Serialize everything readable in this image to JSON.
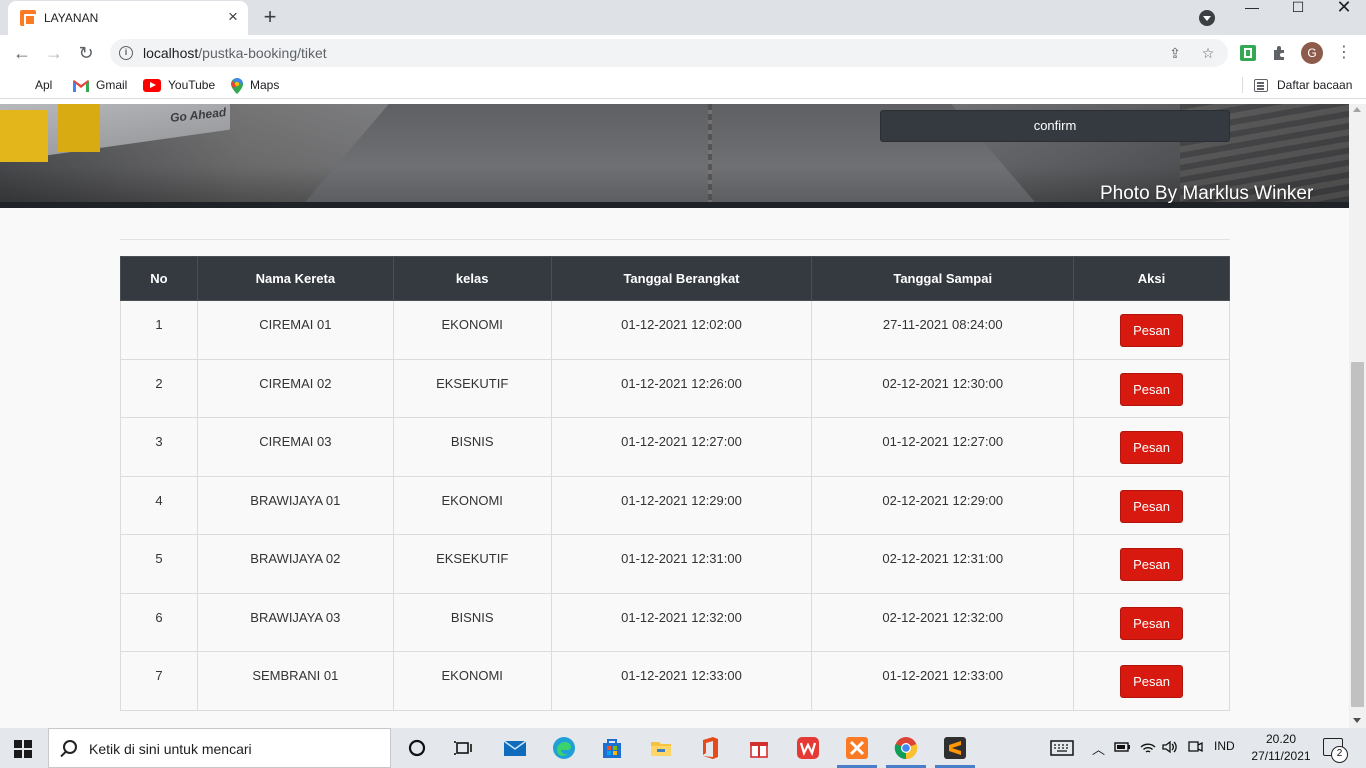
{
  "browser": {
    "tab_title": "LAYANAN",
    "url_host": "localhost",
    "url_path": "/pustka-booking/tiket",
    "bookmarks": [
      {
        "label": "Apl",
        "icon": "apps-grid-icon"
      },
      {
        "label": "Gmail",
        "icon": "gmail-icon"
      },
      {
        "label": "YouTube",
        "icon": "youtube-icon"
      },
      {
        "label": "Maps",
        "icon": "maps-icon"
      }
    ],
    "reading_list": "Daftar bacaan",
    "profile_initial": "G"
  },
  "hero": {
    "brand_text": "Go Ahead",
    "confirm_label": "confirm",
    "photo_credit": "Photo By Marklus Winker"
  },
  "table": {
    "headers": [
      "No",
      "Nama Kereta",
      "kelas",
      "Tanggal Berangkat",
      "Tanggal Sampai",
      "Aksi"
    ],
    "rows": [
      {
        "no": "1",
        "nama": "CIREMAI 01",
        "kelas": "EKONOMI",
        "berangkat": "01-12-2021 12:02:00",
        "sampai": "27-11-2021 08:24:00",
        "aksi": "Pesan"
      },
      {
        "no": "2",
        "nama": "CIREMAI 02",
        "kelas": "EKSEKUTIF",
        "berangkat": "01-12-2021 12:26:00",
        "sampai": "02-12-2021 12:30:00",
        "aksi": "Pesan"
      },
      {
        "no": "3",
        "nama": "CIREMAI 03",
        "kelas": "BISNIS",
        "berangkat": "01-12-2021 12:27:00",
        "sampai": "01-12-2021 12:27:00",
        "aksi": "Pesan"
      },
      {
        "no": "4",
        "nama": "BRAWIJAYA 01",
        "kelas": "EKONOMI",
        "berangkat": "01-12-2021 12:29:00",
        "sampai": "02-12-2021 12:29:00",
        "aksi": "Pesan"
      },
      {
        "no": "5",
        "nama": "BRAWIJAYA 02",
        "kelas": "EKSEKUTIF",
        "berangkat": "01-12-2021 12:31:00",
        "sampai": "02-12-2021 12:31:00",
        "aksi": "Pesan"
      },
      {
        "no": "6",
        "nama": "BRAWIJAYA 03",
        "kelas": "BISNIS",
        "berangkat": "01-12-2021 12:32:00",
        "sampai": "02-12-2021 12:32:00",
        "aksi": "Pesan"
      },
      {
        "no": "7",
        "nama": "SEMBRANI 01",
        "kelas": "EKONOMI",
        "berangkat": "01-12-2021 12:33:00",
        "sampai": "01-12-2021 12:33:00",
        "aksi": "Pesan"
      }
    ]
  },
  "taskbar": {
    "search_placeholder": "Ketik di sini untuk mencari",
    "language": "IND",
    "time": "20.20",
    "date": "27/11/2021",
    "notification_count": "2"
  },
  "colors": {
    "table_header": "#343a40",
    "pesan_button": "#d7190f",
    "confirm_button": "#343a40"
  }
}
